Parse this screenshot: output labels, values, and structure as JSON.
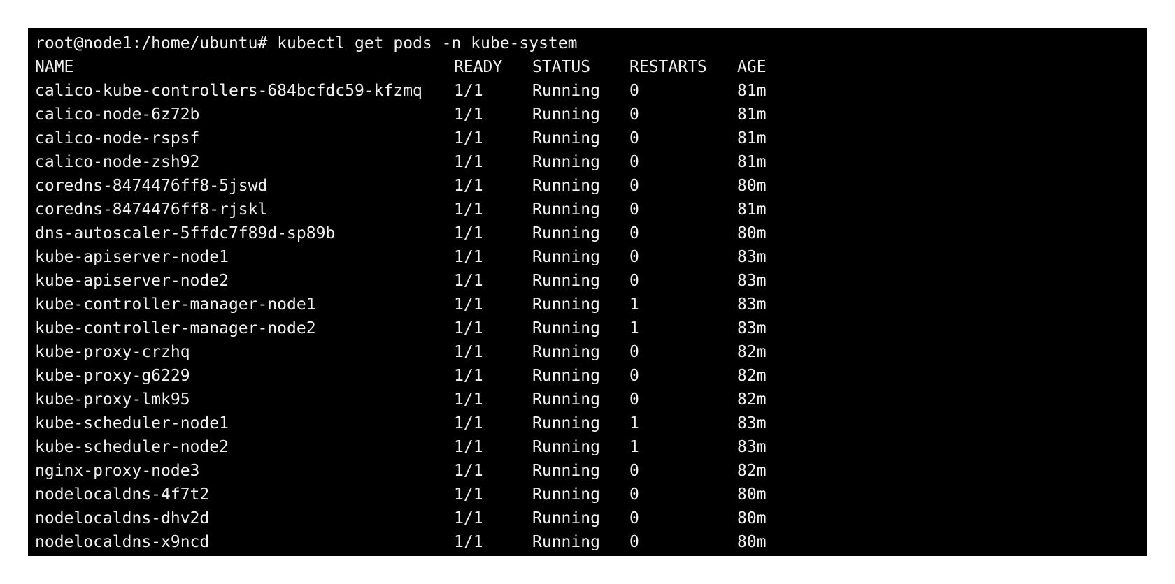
{
  "terminal": {
    "prompt": "root@node1:/home/ubuntu#",
    "command": "kubectl get pods -n kube-system",
    "colors": {
      "background": "#000000",
      "foreground": "#f2f2f2"
    },
    "table": {
      "headers": [
        "NAME",
        "READY",
        "STATUS",
        "RESTARTS",
        "AGE"
      ],
      "rows": [
        [
          "calico-kube-controllers-684bcfdc59-kfzmq",
          "1/1",
          "Running",
          "0",
          "81m"
        ],
        [
          "calico-node-6z72b",
          "1/1",
          "Running",
          "0",
          "81m"
        ],
        [
          "calico-node-rspsf",
          "1/1",
          "Running",
          "0",
          "81m"
        ],
        [
          "calico-node-zsh92",
          "1/1",
          "Running",
          "0",
          "81m"
        ],
        [
          "coredns-8474476ff8-5jswd",
          "1/1",
          "Running",
          "0",
          "80m"
        ],
        [
          "coredns-8474476ff8-rjskl",
          "1/1",
          "Running",
          "0",
          "81m"
        ],
        [
          "dns-autoscaler-5ffdc7f89d-sp89b",
          "1/1",
          "Running",
          "0",
          "80m"
        ],
        [
          "kube-apiserver-node1",
          "1/1",
          "Running",
          "0",
          "83m"
        ],
        [
          "kube-apiserver-node2",
          "1/1",
          "Running",
          "0",
          "83m"
        ],
        [
          "kube-controller-manager-node1",
          "1/1",
          "Running",
          "1",
          "83m"
        ],
        [
          "kube-controller-manager-node2",
          "1/1",
          "Running",
          "1",
          "83m"
        ],
        [
          "kube-proxy-crzhq",
          "1/1",
          "Running",
          "0",
          "82m"
        ],
        [
          "kube-proxy-g6229",
          "1/1",
          "Running",
          "0",
          "82m"
        ],
        [
          "kube-proxy-lmk95",
          "1/1",
          "Running",
          "0",
          "82m"
        ],
        [
          "kube-scheduler-node1",
          "1/1",
          "Running",
          "1",
          "83m"
        ],
        [
          "kube-scheduler-node2",
          "1/1",
          "Running",
          "1",
          "83m"
        ],
        [
          "nginx-proxy-node3",
          "1/1",
          "Running",
          "0",
          "82m"
        ],
        [
          "nodelocaldns-4f7t2",
          "1/1",
          "Running",
          "0",
          "80m"
        ],
        [
          "nodelocaldns-dhv2d",
          "1/1",
          "Running",
          "0",
          "80m"
        ],
        [
          "nodelocaldns-x9ncd",
          "1/1",
          "Running",
          "0",
          "80m"
        ]
      ]
    }
  }
}
